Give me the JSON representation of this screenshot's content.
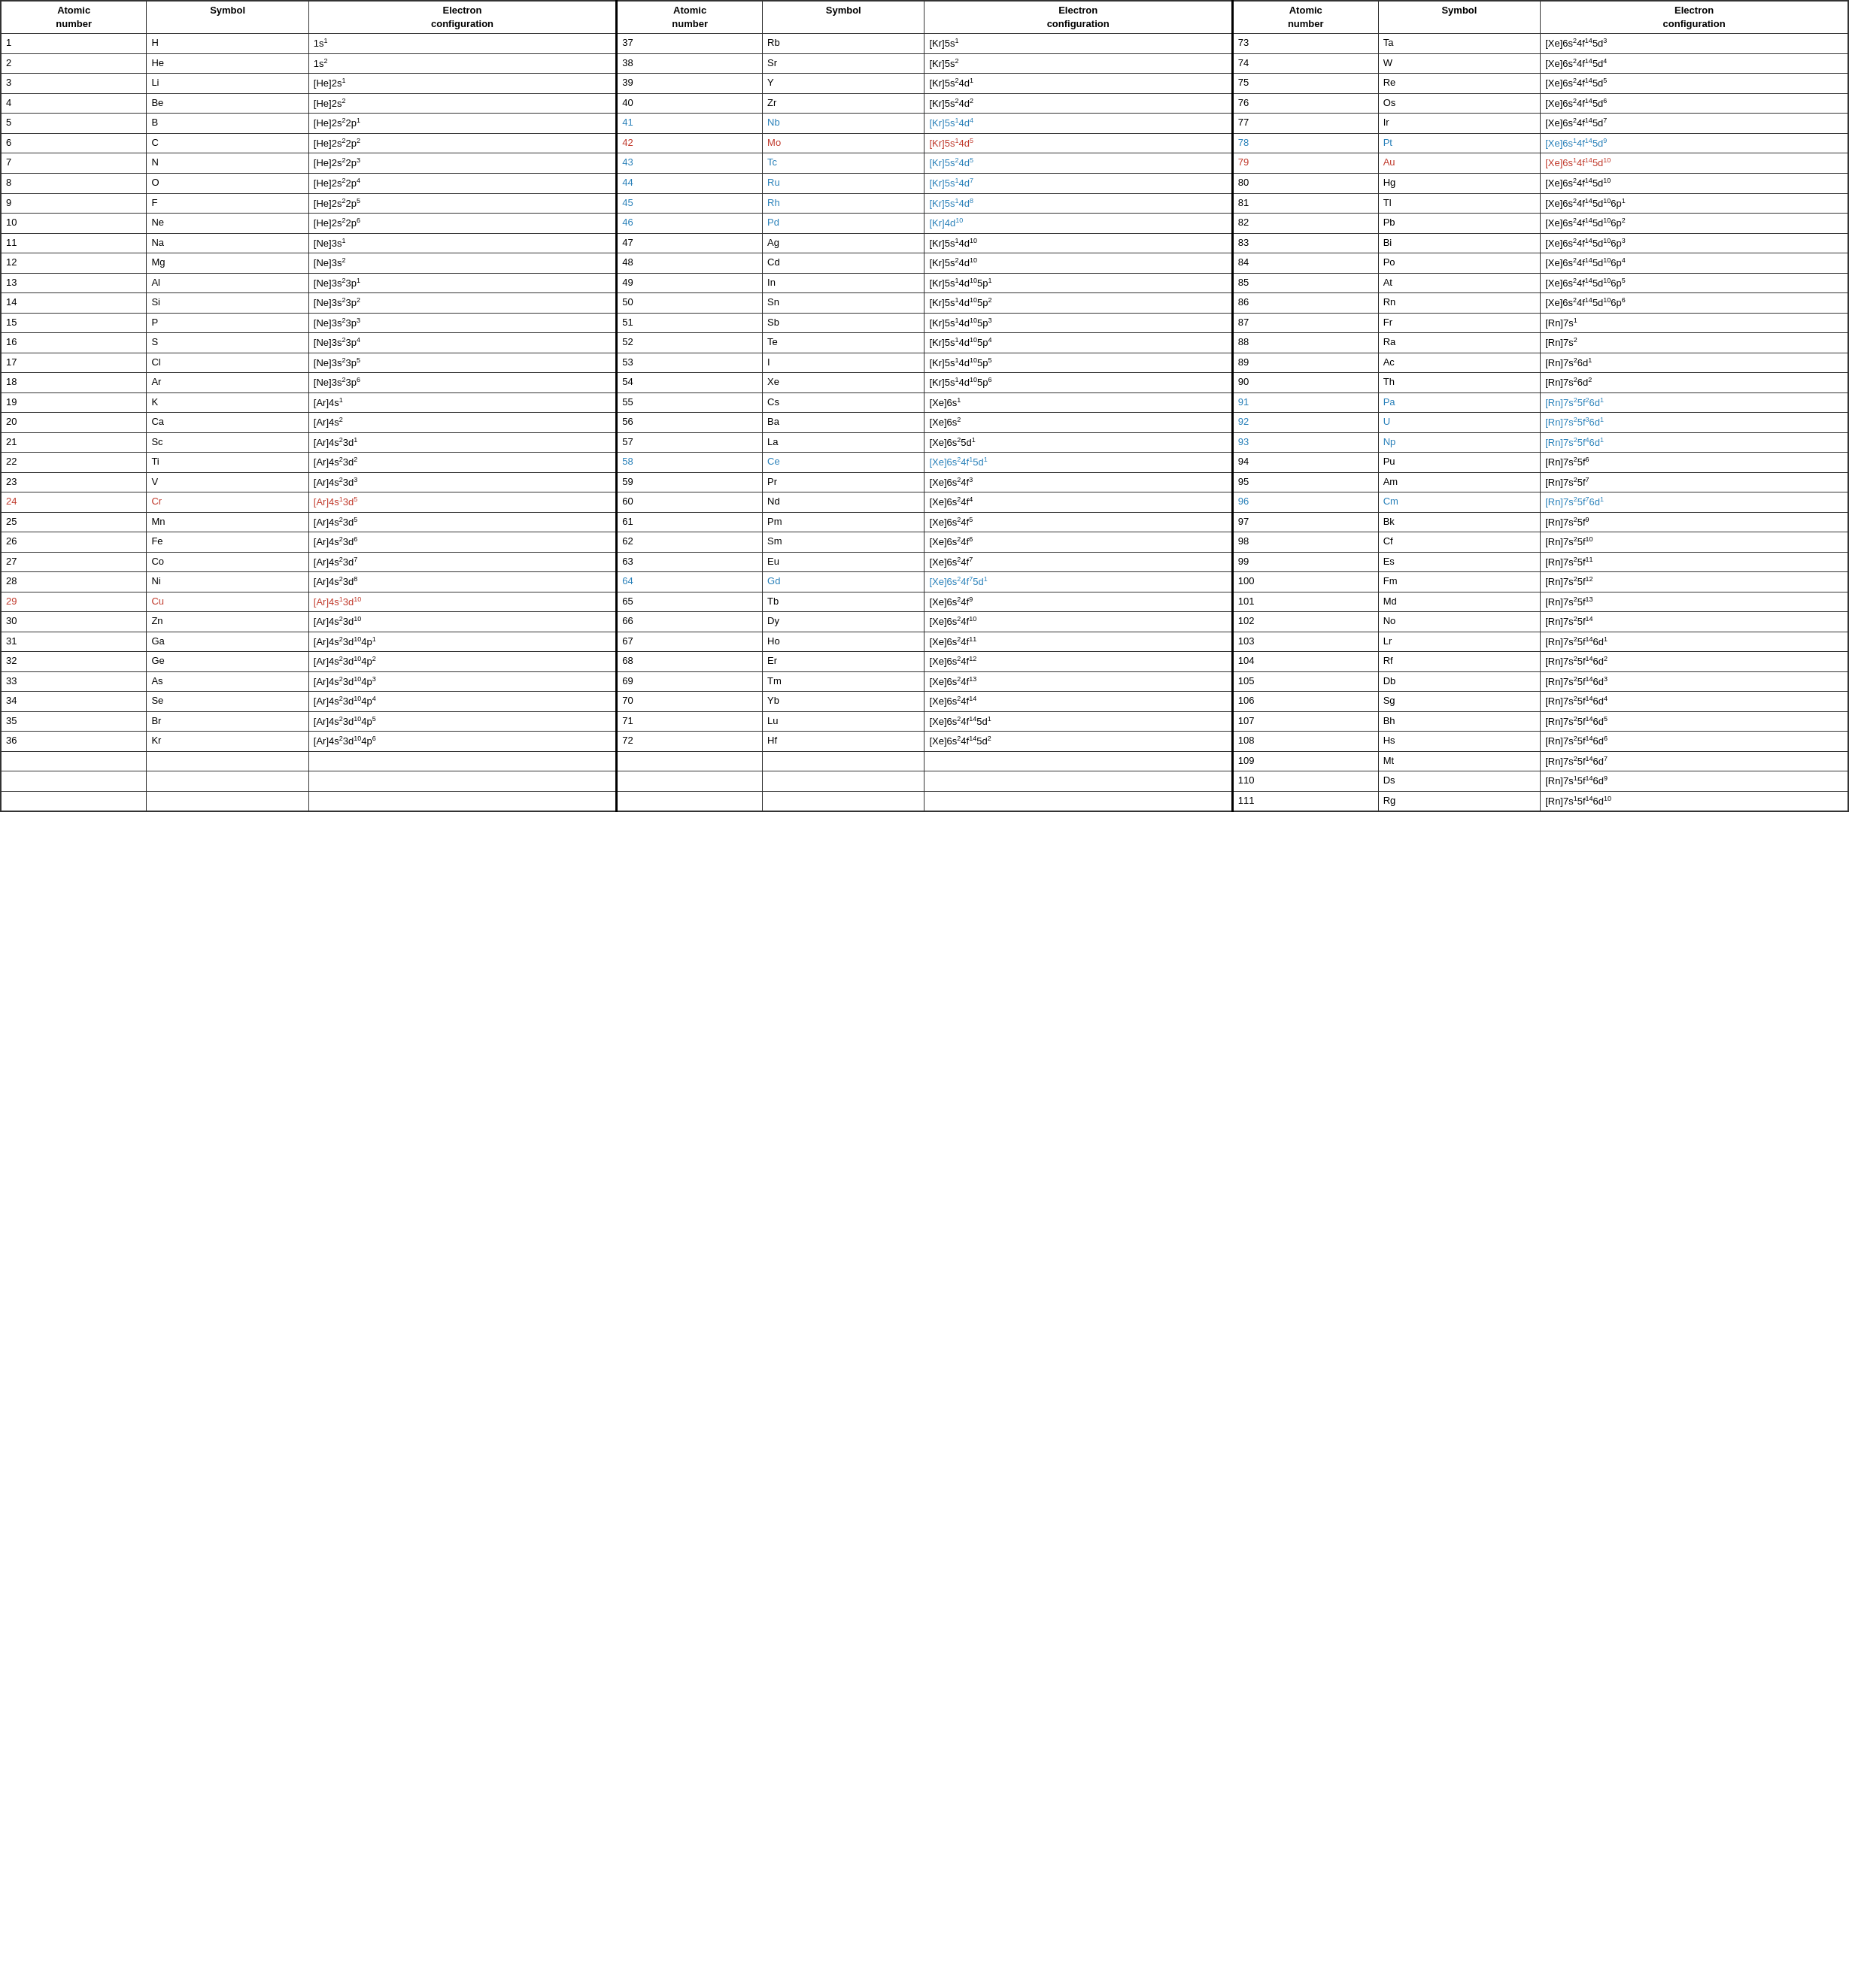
{
  "headers": [
    {
      "num": "Atomic number",
      "sym": "Symbol",
      "ec": "Electron configuration"
    },
    {
      "num": "Atomic number",
      "sym": "Symbol",
      "ec": "Electron configuration"
    },
    {
      "num": "Atomic number",
      "sym": "Symbol",
      "ec": "Electron configuration"
    }
  ],
  "col1": [
    {
      "n": "1",
      "s": "H",
      "e": "1s<sup>1</sup>",
      "nc": "",
      "ns": "",
      "ne": ""
    },
    {
      "n": "2",
      "s": "He",
      "e": "1s<sup>2</sup>",
      "nc": "",
      "ns": "",
      "ne": ""
    },
    {
      "n": "3",
      "s": "Li",
      "e": "[He]2s<sup>1</sup>",
      "nc": "",
      "ns": "",
      "ne": ""
    },
    {
      "n": "4",
      "s": "Be",
      "e": "[He]2s<sup>2</sup>",
      "nc": "",
      "ns": "",
      "ne": ""
    },
    {
      "n": "5",
      "s": "B",
      "e": "[He]2s<sup>2</sup>2p<sup>1</sup>",
      "nc": "",
      "ns": "",
      "ne": ""
    },
    {
      "n": "6",
      "s": "C",
      "e": "[He]2s<sup>2</sup>2p<sup>2</sup>",
      "nc": "",
      "ns": "",
      "ne": ""
    },
    {
      "n": "7",
      "s": "N",
      "e": "[He]2s<sup>2</sup>2p<sup>3</sup>",
      "nc": "",
      "ns": "",
      "ne": ""
    },
    {
      "n": "8",
      "s": "O",
      "e": "[He]2s<sup>2</sup>2p<sup>4</sup>",
      "nc": "",
      "ns": "",
      "ne": ""
    },
    {
      "n": "9",
      "s": "F",
      "e": "[He]2s<sup>2</sup>2p<sup>5</sup>",
      "nc": "",
      "ns": "",
      "ne": ""
    },
    {
      "n": "10",
      "s": "Ne",
      "e": "[He]2s<sup>2</sup>2p<sup>6</sup>",
      "nc": "",
      "ns": "",
      "ne": ""
    },
    {
      "n": "11",
      "s": "Na",
      "e": "[Ne]3s<sup>1</sup>",
      "nc": "",
      "ns": "",
      "ne": ""
    },
    {
      "n": "12",
      "s": "Mg",
      "e": "[Ne]3s<sup>2</sup>",
      "nc": "",
      "ns": "",
      "ne": ""
    },
    {
      "n": "13",
      "s": "Al",
      "e": "[Ne]3s<sup>2</sup>3p<sup>1</sup>",
      "nc": "",
      "ns": "",
      "ne": ""
    },
    {
      "n": "14",
      "s": "Si",
      "e": "[Ne]3s<sup>2</sup>3p<sup>2</sup>",
      "nc": "",
      "ns": "",
      "ne": ""
    },
    {
      "n": "15",
      "s": "P",
      "e": "[Ne]3s<sup>2</sup>3p<sup>3</sup>",
      "nc": "",
      "ns": "",
      "ne": ""
    },
    {
      "n": "16",
      "s": "S",
      "e": "[Ne]3s<sup>2</sup>3p<sup>4</sup>",
      "nc": "",
      "ns": "",
      "ne": ""
    },
    {
      "n": "17",
      "s": "Cl",
      "e": "[Ne]3s<sup>2</sup>3p<sup>5</sup>",
      "nc": "",
      "ns": "",
      "ne": ""
    },
    {
      "n": "18",
      "s": "Ar",
      "e": "[Ne]3s<sup>2</sup>3p<sup>6</sup>",
      "nc": "",
      "ns": "",
      "ne": ""
    },
    {
      "n": "19",
      "s": "K",
      "e": "[Ar]4s<sup>1</sup>",
      "nc": "",
      "ns": "",
      "ne": ""
    },
    {
      "n": "20",
      "s": "Ca",
      "e": "[Ar]4s<sup>2</sup>",
      "nc": "",
      "ns": "",
      "ne": ""
    },
    {
      "n": "21",
      "s": "Sc",
      "e": "[Ar]4s<sup>2</sup>3d<sup>1</sup>",
      "nc": "",
      "ns": "",
      "ne": ""
    },
    {
      "n": "22",
      "s": "Ti",
      "e": "[Ar]4s<sup>2</sup>3d<sup>2</sup>",
      "nc": "",
      "ns": "",
      "ne": ""
    },
    {
      "n": "23",
      "s": "V",
      "e": "[Ar]4s<sup>2</sup>3d<sup>3</sup>",
      "nc": "",
      "ns": "",
      "ne": ""
    },
    {
      "n": "24",
      "s": "Cr",
      "e": "[Ar]4s<sup>1</sup>3d<sup>5</sup>",
      "nc": "red",
      "ns": "red",
      "ne": "red"
    },
    {
      "n": "25",
      "s": "Mn",
      "e": "[Ar]4s<sup>2</sup>3d<sup>5</sup>",
      "nc": "",
      "ns": "",
      "ne": ""
    },
    {
      "n": "26",
      "s": "Fe",
      "e": "[Ar]4s<sup>2</sup>3d<sup>6</sup>",
      "nc": "",
      "ns": "",
      "ne": ""
    },
    {
      "n": "27",
      "s": "Co",
      "e": "[Ar]4s<sup>2</sup>3d<sup>7</sup>",
      "nc": "",
      "ns": "",
      "ne": ""
    },
    {
      "n": "28",
      "s": "Ni",
      "e": "[Ar]4s<sup>2</sup>3d<sup>8</sup>",
      "nc": "",
      "ns": "",
      "ne": ""
    },
    {
      "n": "29",
      "s": "Cu",
      "e": "[Ar]4s<sup>1</sup>3d<sup>10</sup>",
      "nc": "red",
      "ns": "red",
      "ne": "red"
    },
    {
      "n": "30",
      "s": "Zn",
      "e": "[Ar]4s<sup>2</sup>3d<sup>10</sup>",
      "nc": "",
      "ns": "",
      "ne": ""
    },
    {
      "n": "31",
      "s": "Ga",
      "e": "[Ar]4s<sup>2</sup>3d<sup>10</sup>4p<sup>1</sup>",
      "nc": "",
      "ns": "",
      "ne": ""
    },
    {
      "n": "32",
      "s": "Ge",
      "e": "[Ar]4s<sup>2</sup>3d<sup>10</sup>4p<sup>2</sup>",
      "nc": "",
      "ns": "",
      "ne": ""
    },
    {
      "n": "33",
      "s": "As",
      "e": "[Ar]4s<sup>2</sup>3d<sup>10</sup>4p<sup>3</sup>",
      "nc": "",
      "ns": "",
      "ne": ""
    },
    {
      "n": "34",
      "s": "Se",
      "e": "[Ar]4s<sup>2</sup>3d<sup>10</sup>4p<sup>4</sup>",
      "nc": "",
      "ns": "",
      "ne": ""
    },
    {
      "n": "35",
      "s": "Br",
      "e": "[Ar]4s<sup>2</sup>3d<sup>10</sup>4p<sup>5</sup>",
      "nc": "",
      "ns": "",
      "ne": ""
    },
    {
      "n": "36",
      "s": "Kr",
      "e": "[Ar]4s<sup>2</sup>3d<sup>10</sup>4p<sup>6</sup>",
      "nc": "",
      "ns": "",
      "ne": ""
    }
  ],
  "col2": [
    {
      "n": "37",
      "s": "Rb",
      "e": "[Kr]5s<sup>1</sup>",
      "nc": "",
      "ns": "",
      "ne": ""
    },
    {
      "n": "38",
      "s": "Sr",
      "e": "[Kr]5s<sup>2</sup>",
      "nc": "",
      "ns": "",
      "ne": ""
    },
    {
      "n": "39",
      "s": "Y",
      "e": "[Kr]5s<sup>2</sup>4d<sup>1</sup>",
      "nc": "",
      "ns": "",
      "ne": ""
    },
    {
      "n": "40",
      "s": "Zr",
      "e": "[Kr]5s<sup>2</sup>4d<sup>2</sup>",
      "nc": "",
      "ns": "",
      "ne": ""
    },
    {
      "n": "41",
      "s": "Nb",
      "e": "[Kr]5s<sup>1</sup>4d<sup>4</sup>",
      "nc": "blue",
      "ns": "blue",
      "ne": "blue"
    },
    {
      "n": "42",
      "s": "Mo",
      "e": "[Kr]5s<sup>1</sup>4d<sup>5</sup>",
      "nc": "red",
      "ns": "red",
      "ne": "red"
    },
    {
      "n": "43",
      "s": "Tc",
      "e": "[Kr]5s<sup>2</sup>4d<sup>5</sup>",
      "nc": "blue",
      "ns": "blue",
      "ne": "blue"
    },
    {
      "n": "44",
      "s": "Ru",
      "e": "[Kr]5s<sup>1</sup>4d<sup>7</sup>",
      "nc": "blue",
      "ns": "blue",
      "ne": "blue"
    },
    {
      "n": "45",
      "s": "Rh",
      "e": "[Kr]5s<sup>1</sup>4d<sup>8</sup>",
      "nc": "blue",
      "ns": "blue",
      "ne": "blue"
    },
    {
      "n": "46",
      "s": "Pd",
      "e": "[Kr]4d<sup>10</sup>",
      "nc": "blue",
      "ns": "blue",
      "ne": "blue"
    },
    {
      "n": "47",
      "s": "Ag",
      "e": "[Kr]5s<sup>1</sup>4d<sup>10</sup>",
      "nc": "",
      "ns": "",
      "ne": ""
    },
    {
      "n": "48",
      "s": "Cd",
      "e": "[Kr]5s<sup>2</sup>4d<sup>10</sup>",
      "nc": "",
      "ns": "",
      "ne": ""
    },
    {
      "n": "49",
      "s": "In",
      "e": "[Kr]5s<sup>1</sup>4d<sup>10</sup>5p<sup>1</sup>",
      "nc": "",
      "ns": "",
      "ne": ""
    },
    {
      "n": "50",
      "s": "Sn",
      "e": "[Kr]5s<sup>1</sup>4d<sup>10</sup>5p<sup>2</sup>",
      "nc": "",
      "ns": "",
      "ne": ""
    },
    {
      "n": "51",
      "s": "Sb",
      "e": "[Kr]5s<sup>1</sup>4d<sup>10</sup>5p<sup>3</sup>",
      "nc": "",
      "ns": "",
      "ne": ""
    },
    {
      "n": "52",
      "s": "Te",
      "e": "[Kr]5s<sup>1</sup>4d<sup>10</sup>5p<sup>4</sup>",
      "nc": "",
      "ns": "",
      "ne": ""
    },
    {
      "n": "53",
      "s": "I",
      "e": "[Kr]5s<sup>1</sup>4d<sup>10</sup>5p<sup>5</sup>",
      "nc": "",
      "ns": "",
      "ne": ""
    },
    {
      "n": "54",
      "s": "Xe",
      "e": "[Kr]5s<sup>1</sup>4d<sup>10</sup>5p<sup>6</sup>",
      "nc": "",
      "ns": "",
      "ne": ""
    },
    {
      "n": "55",
      "s": "Cs",
      "e": "[Xe]6s<sup>1</sup>",
      "nc": "",
      "ns": "",
      "ne": ""
    },
    {
      "n": "56",
      "s": "Ba",
      "e": "[Xe]6s<sup>2</sup>",
      "nc": "",
      "ns": "",
      "ne": ""
    },
    {
      "n": "57",
      "s": "La",
      "e": "[Xe]6s<sup>2</sup>5d<sup>1</sup>",
      "nc": "",
      "ns": "",
      "ne": ""
    },
    {
      "n": "58",
      "s": "Ce",
      "e": "[Xe]6s<sup>2</sup>4f<sup>1</sup>5d<sup>1</sup>",
      "nc": "blue",
      "ns": "blue",
      "ne": "blue"
    },
    {
      "n": "59",
      "s": "Pr",
      "e": "[Xe]6s<sup>2</sup>4f<sup>3</sup>",
      "nc": "",
      "ns": "",
      "ne": ""
    },
    {
      "n": "60",
      "s": "Nd",
      "e": "[Xe]6s<sup>2</sup>4f<sup>4</sup>",
      "nc": "",
      "ns": "",
      "ne": ""
    },
    {
      "n": "61",
      "s": "Pm",
      "e": "[Xe]6s<sup>2</sup>4f<sup>5</sup>",
      "nc": "",
      "ns": "",
      "ne": ""
    },
    {
      "n": "62",
      "s": "Sm",
      "e": "[Xe]6s<sup>2</sup>4f<sup>6</sup>",
      "nc": "",
      "ns": "",
      "ne": ""
    },
    {
      "n": "63",
      "s": "Eu",
      "e": "[Xe]6s<sup>2</sup>4f<sup>7</sup>",
      "nc": "",
      "ns": "",
      "ne": ""
    },
    {
      "n": "64",
      "s": "Gd",
      "e": "[Xe]6s<sup>2</sup>4f<sup>7</sup>5d<sup>1</sup>",
      "nc": "blue",
      "ns": "blue",
      "ne": "blue"
    },
    {
      "n": "65",
      "s": "Tb",
      "e": "[Xe]6s<sup>2</sup>4f<sup>9</sup>",
      "nc": "",
      "ns": "",
      "ne": ""
    },
    {
      "n": "66",
      "s": "Dy",
      "e": "[Xe]6s<sup>2</sup>4f<sup>10</sup>",
      "nc": "",
      "ns": "",
      "ne": ""
    },
    {
      "n": "67",
      "s": "Ho",
      "e": "[Xe]6s<sup>2</sup>4f<sup>11</sup>",
      "nc": "",
      "ns": "",
      "ne": ""
    },
    {
      "n": "68",
      "s": "Er",
      "e": "[Xe]6s<sup>2</sup>4f<sup>12</sup>",
      "nc": "",
      "ns": "",
      "ne": ""
    },
    {
      "n": "69",
      "s": "Tm",
      "e": "[Xe]6s<sup>2</sup>4f<sup>13</sup>",
      "nc": "",
      "ns": "",
      "ne": ""
    },
    {
      "n": "70",
      "s": "Yb",
      "e": "[Xe]6s<sup>2</sup>4f<sup>14</sup>",
      "nc": "",
      "ns": "",
      "ne": ""
    },
    {
      "n": "71",
      "s": "Lu",
      "e": "[Xe]6s<sup>2</sup>4f<sup>14</sup>5d<sup>1</sup>",
      "nc": "",
      "ns": "",
      "ne": ""
    },
    {
      "n": "72",
      "s": "Hf",
      "e": "[Xe]6s<sup>2</sup>4f<sup>14</sup>5d<sup>2</sup>",
      "nc": "",
      "ns": "",
      "ne": ""
    }
  ],
  "col3": [
    {
      "n": "73",
      "s": "Ta",
      "e": "[Xe]6s<sup>2</sup>4f<sup>14</sup>5d<sup>3</sup>",
      "nc": "",
      "ns": "",
      "ne": ""
    },
    {
      "n": "74",
      "s": "W",
      "e": "[Xe]6s<sup>2</sup>4f<sup>14</sup>5d<sup>4</sup>",
      "nc": "",
      "ns": "",
      "ne": ""
    },
    {
      "n": "75",
      "s": "Re",
      "e": "[Xe]6s<sup>2</sup>4f<sup>14</sup>5d<sup>5</sup>",
      "nc": "",
      "ns": "",
      "ne": ""
    },
    {
      "n": "76",
      "s": "Os",
      "e": "[Xe]6s<sup>2</sup>4f<sup>14</sup>5d<sup>6</sup>",
      "nc": "",
      "ns": "",
      "ne": ""
    },
    {
      "n": "77",
      "s": "Ir",
      "e": "[Xe]6s<sup>2</sup>4f<sup>14</sup>5d<sup>7</sup>",
      "nc": "",
      "ns": "",
      "ne": ""
    },
    {
      "n": "78",
      "s": "Pt",
      "e": "[Xe]6s<sup>1</sup>4f<sup>14</sup>5d<sup>9</sup>",
      "nc": "blue",
      "ns": "blue",
      "ne": "blue"
    },
    {
      "n": "79",
      "s": "Au",
      "e": "[Xe]6s<sup>1</sup>4f<sup>14</sup>5d<sup>10</sup>",
      "nc": "red",
      "ns": "red",
      "ne": "red"
    },
    {
      "n": "80",
      "s": "Hg",
      "e": "[Xe]6s<sup>2</sup>4f<sup>14</sup>5d<sup>10</sup>",
      "nc": "",
      "ns": "",
      "ne": ""
    },
    {
      "n": "81",
      "s": "Tl",
      "e": "[Xe]6s<sup>2</sup>4f<sup>14</sup>5d<sup>10</sup>6p<sup>1</sup>",
      "nc": "",
      "ns": "",
      "ne": ""
    },
    {
      "n": "82",
      "s": "Pb",
      "e": "[Xe]6s<sup>2</sup>4f<sup>14</sup>5d<sup>10</sup>6p<sup>2</sup>",
      "nc": "",
      "ns": "",
      "ne": ""
    },
    {
      "n": "83",
      "s": "Bi",
      "e": "[Xe]6s<sup>2</sup>4f<sup>14</sup>5d<sup>10</sup>6p<sup>3</sup>",
      "nc": "",
      "ns": "",
      "ne": ""
    },
    {
      "n": "84",
      "s": "Po",
      "e": "[Xe]6s<sup>2</sup>4f<sup>14</sup>5d<sup>10</sup>6p<sup>4</sup>",
      "nc": "",
      "ns": "",
      "ne": ""
    },
    {
      "n": "85",
      "s": "At",
      "e": "[Xe]6s<sup>2</sup>4f<sup>14</sup>5d<sup>10</sup>6p<sup>5</sup>",
      "nc": "",
      "ns": "",
      "ne": ""
    },
    {
      "n": "86",
      "s": "Rn",
      "e": "[Xe]6s<sup>2</sup>4f<sup>14</sup>5d<sup>10</sup>6p<sup>6</sup>",
      "nc": "",
      "ns": "",
      "ne": ""
    },
    {
      "n": "87",
      "s": "Fr",
      "e": "[Rn]7s<sup>1</sup>",
      "nc": "",
      "ns": "",
      "ne": ""
    },
    {
      "n": "88",
      "s": "Ra",
      "e": "[Rn]7s<sup>2</sup>",
      "nc": "",
      "ns": "",
      "ne": ""
    },
    {
      "n": "89",
      "s": "Ac",
      "e": "[Rn]7s<sup>2</sup>6d<sup>1</sup>",
      "nc": "",
      "ns": "",
      "ne": ""
    },
    {
      "n": "90",
      "s": "Th",
      "e": "[Rn]7s<sup>2</sup>6d<sup>2</sup>",
      "nc": "",
      "ns": "",
      "ne": ""
    },
    {
      "n": "91",
      "s": "Pa",
      "e": "[Rn]7s<sup>2</sup>5f<sup>2</sup>6d<sup>1</sup>",
      "nc": "blue",
      "ns": "blue",
      "ne": "blue"
    },
    {
      "n": "92",
      "s": "U",
      "e": "[Rn]7s<sup>2</sup>5f<sup>3</sup>6d<sup>1</sup>",
      "nc": "blue",
      "ns": "blue",
      "ne": "blue"
    },
    {
      "n": "93",
      "s": "Np",
      "e": "[Rn]7s<sup>2</sup>5f<sup>4</sup>6d<sup>1</sup>",
      "nc": "blue",
      "ns": "blue",
      "ne": "blue"
    },
    {
      "n": "94",
      "s": "Pu",
      "e": "[Rn]7s<sup>2</sup>5f<sup>6</sup>",
      "nc": "",
      "ns": "",
      "ne": ""
    },
    {
      "n": "95",
      "s": "Am",
      "e": "[Rn]7s<sup>2</sup>5f<sup>7</sup>",
      "nc": "",
      "ns": "",
      "ne": ""
    },
    {
      "n": "96",
      "s": "Cm",
      "e": "[Rn]7s<sup>2</sup>5f<sup>7</sup>6d<sup>1</sup>",
      "nc": "blue",
      "ns": "blue",
      "ne": "blue"
    },
    {
      "n": "97",
      "s": "Bk",
      "e": "[Rn]7s<sup>2</sup>5f<sup>9</sup>",
      "nc": "",
      "ns": "",
      "ne": ""
    },
    {
      "n": "98",
      "s": "Cf",
      "e": "[Rn]7s<sup>2</sup>5f<sup>10</sup>",
      "nc": "",
      "ns": "",
      "ne": ""
    },
    {
      "n": "99",
      "s": "Es",
      "e": "[Rn]7s<sup>2</sup>5f<sup>11</sup>",
      "nc": "",
      "ns": "",
      "ne": ""
    },
    {
      "n": "100",
      "s": "Fm",
      "e": "[Rn]7s<sup>2</sup>5f<sup>12</sup>",
      "nc": "",
      "ns": "",
      "ne": ""
    },
    {
      "n": "101",
      "s": "Md",
      "e": "[Rn]7s<sup>2</sup>5f<sup>13</sup>",
      "nc": "",
      "ns": "",
      "ne": ""
    },
    {
      "n": "102",
      "s": "No",
      "e": "[Rn]7s<sup>2</sup>5f<sup>14</sup>",
      "nc": "",
      "ns": "",
      "ne": ""
    },
    {
      "n": "103",
      "s": "Lr",
      "e": "[Rn]7s<sup>2</sup>5f<sup>14</sup>6d<sup>1</sup>",
      "nc": "",
      "ns": "",
      "ne": ""
    },
    {
      "n": "104",
      "s": "Rf",
      "e": "[Rn]7s<sup>2</sup>5f<sup>14</sup>6d<sup>2</sup>",
      "nc": "",
      "ns": "",
      "ne": ""
    },
    {
      "n": "105",
      "s": "Db",
      "e": "[Rn]7s<sup>2</sup>5f<sup>14</sup>6d<sup>3</sup>",
      "nc": "",
      "ns": "",
      "ne": ""
    },
    {
      "n": "106",
      "s": "Sg",
      "e": "[Rn]7s<sup>2</sup>5f<sup>14</sup>6d<sup>4</sup>",
      "nc": "",
      "ns": "",
      "ne": ""
    },
    {
      "n": "107",
      "s": "Bh",
      "e": "[Rn]7s<sup>2</sup>5f<sup>14</sup>6d<sup>5</sup>",
      "nc": "",
      "ns": "",
      "ne": ""
    },
    {
      "n": "108",
      "s": "Hs",
      "e": "[Rn]7s<sup>2</sup>5f<sup>14</sup>6d<sup>6</sup>",
      "nc": "",
      "ns": "",
      "ne": ""
    },
    {
      "n": "109",
      "s": "Mt",
      "e": "[Rn]7s<sup>2</sup>5f<sup>14</sup>6d<sup>7</sup>",
      "nc": "",
      "ns": "",
      "ne": ""
    },
    {
      "n": "110",
      "s": "Ds",
      "e": "[Rn]7s<sup>1</sup>5f<sup>14</sup>6d<sup>9</sup>",
      "nc": "",
      "ns": "",
      "ne": ""
    },
    {
      "n": "111",
      "s": "Rg",
      "e": "[Rn]7s<sup>1</sup>5f<sup>14</sup>6d<sup>10</sup>",
      "nc": "",
      "ns": "",
      "ne": ""
    }
  ]
}
